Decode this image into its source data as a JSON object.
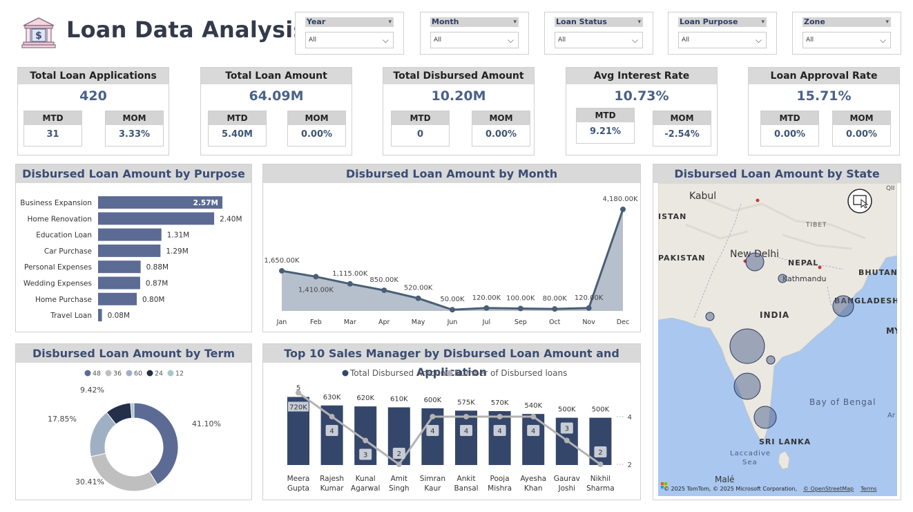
{
  "header": {
    "title": "Loan Data Analysis"
  },
  "slicers": [
    {
      "label": "Year",
      "value": "All"
    },
    {
      "label": "Month",
      "value": "All"
    },
    {
      "label": "Loan Status",
      "value": "All"
    },
    {
      "label": "Loan Purpose",
      "value": "All"
    },
    {
      "label": "Zone",
      "value": "All"
    }
  ],
  "kpis": [
    {
      "title": "Total Loan Applications",
      "value": "420",
      "mtd_label": "MTD",
      "mtd": "31",
      "mom_label": "MOM",
      "mom": "3.33%"
    },
    {
      "title": "Total Loan Amount",
      "value": "64.09M",
      "mtd_label": "MTD",
      "mtd": "5.40M",
      "mom_label": "MOM",
      "mom": "0.00%"
    },
    {
      "title": "Total Disbursed Amount",
      "value": "10.20M",
      "mtd_label": "MTD",
      "mtd": "0",
      "mom_label": "MOM",
      "mom": "0.00%"
    },
    {
      "title": "Avg Interest Rate",
      "value": "10.73%",
      "mtd_label": "MTD",
      "mtd": "9.21%",
      "mom_label": "MOM",
      "mom": "-2.54%"
    },
    {
      "title": "Loan Approval Rate",
      "value": "15.71%",
      "mtd_label": "MTD",
      "mtd": "0.00%",
      "mom_label": "MOM",
      "mom": "0.00%"
    }
  ],
  "panels": {
    "purpose_title": "Disbursed Loan Amount by Purpose",
    "month_title": "Disbursed Loan Amount by Month",
    "state_title": "Disbursed Loan Amount by State",
    "term_title": "Disbursed Loan Amount by Term",
    "managers_title": "Top 10 Sales Manager by Disbursed Loan Amount and Application"
  },
  "colors": {
    "bar": "#5b6b94",
    "dark_bar": "#35466b",
    "line_gray": "#b3b3b3",
    "area_fill": "#b6c0cc",
    "area_line": "#4a5e75",
    "term_colors": [
      "#5b6b94",
      "#bfbfbf",
      "#9fb0c4",
      "#243049",
      "#a8c6cc"
    ]
  },
  "chart_data": [
    {
      "type": "bar",
      "orientation": "horizontal",
      "categories": [
        "Business Expansion",
        "Home Renovation",
        "Education Loan",
        "Car Purchase",
        "Personal Expenses",
        "Wedding Expenses",
        "Home Purchase",
        "Travel Loan"
      ],
      "values": [
        2.57,
        2.4,
        1.31,
        1.29,
        0.88,
        0.87,
        0.8,
        0.08
      ],
      "labels": [
        "2.57M",
        "2.40M",
        "1.31M",
        "1.29M",
        "0.88M",
        "0.87M",
        "0.80M",
        "0.08M"
      ]
    },
    {
      "type": "area",
      "categories": [
        "Jan",
        "Feb",
        "Mar",
        "Apr",
        "May",
        "Jun",
        "Jul",
        "Sep",
        "Oct",
        "Nov",
        "Dec"
      ],
      "values": [
        1650,
        1410,
        1115,
        850,
        520,
        50,
        120,
        100,
        80,
        120,
        4180
      ],
      "labels": [
        "1,650.00K",
        "1,410.00K",
        "1,115.00K",
        "850.00K",
        "520.00K",
        "50.00K",
        "120.00K",
        "100.00K",
        "80.00K",
        "120.00K",
        "4,180.00K"
      ]
    },
    {
      "type": "pie",
      "legend": [
        "48",
        "36",
        "60",
        "24",
        "12"
      ],
      "values": [
        41.1,
        30.41,
        17.85,
        9.42,
        1.22
      ],
      "labels": [
        "41.10%",
        "30.41%",
        "17.85%",
        "9.42%",
        ""
      ]
    },
    {
      "type": "bar",
      "categories": [
        "Meera Gupta",
        "Rajesh Kumar",
        "Kunal Agarwal",
        "Amit Singh",
        "Simran Kaur",
        "Ankit Bansal",
        "Pooja Mishra",
        "Ayesha Khan",
        "Gaurav Joshi",
        "Nikhil Sharma"
      ],
      "legend": [
        "Total Disbursed Amount",
        "Number of Disbursed loans"
      ],
      "series": [
        {
          "name": "Total Disbursed Amount",
          "values": [
            720,
            630,
            620,
            610,
            600,
            575,
            570,
            540,
            500,
            500
          ],
          "labels": [
            "720K",
            "630K",
            "620K",
            "610K",
            "600K",
            "575K",
            "570K",
            "540K",
            "500K",
            "500K"
          ]
        },
        {
          "name": "Number of Disbursed loans",
          "values": [
            5,
            4,
            3,
            2,
            4,
            4,
            4,
            4,
            3,
            2
          ],
          "labels": [
            "5",
            "4",
            "3",
            "2",
            "4",
            "4",
            "4",
            "4",
            "3",
            "2"
          ]
        }
      ],
      "y2_ticks": [
        "4",
        "2"
      ]
    }
  ],
  "map": {
    "places": [
      "Kabul",
      "ISTAN",
      "PAKISTAN",
      "New Delhi",
      "NEPAL",
      "Kathmandu",
      "BHUTAN",
      "TIBET",
      "BANGLADESH",
      "INDIA",
      "MY",
      "Bay of Bengal",
      "Ar",
      "SRI LANKA",
      "Laccadive",
      "Sea",
      "Malé",
      "QII"
    ],
    "attribution": "© 2025 TomTom, © 2025 Microsoft Corporation,",
    "osm": "© OpenStreetMap",
    "terms": "Terms"
  }
}
